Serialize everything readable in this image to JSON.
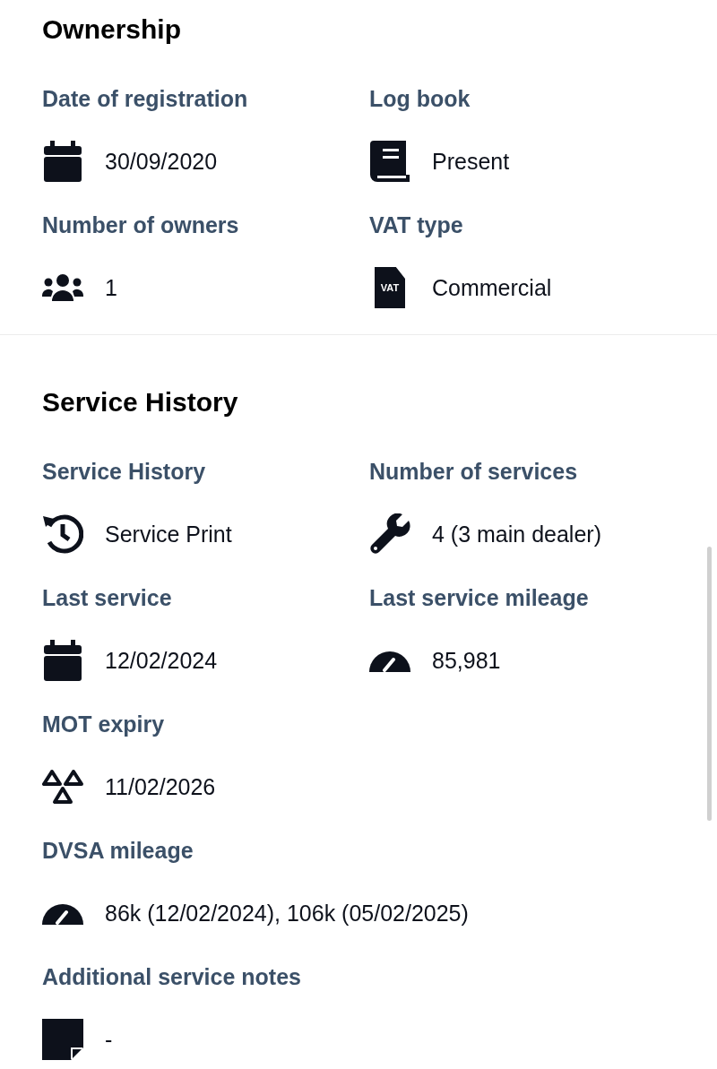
{
  "sections": [
    {
      "title": "Ownership",
      "fields": [
        {
          "label": "Date of registration",
          "kind": "calendar",
          "value": "30/09/2020"
        },
        {
          "label": "Log book",
          "kind": "book",
          "value": "Present"
        },
        {
          "label": "Number of owners",
          "kind": "people",
          "value": "1"
        },
        {
          "label": "VAT type",
          "kind": "document",
          "icon_text": "VAT",
          "value": "Commercial"
        }
      ]
    },
    {
      "title": "Service History",
      "fields": [
        {
          "label": "Service History",
          "kind": "history",
          "value": "Service Print"
        },
        {
          "label": "Number of services",
          "kind": "wrench",
          "value": "4 (3 main dealer)"
        },
        {
          "label": "Last service",
          "kind": "calendar",
          "value": "12/02/2024"
        },
        {
          "label": "Last service mileage",
          "kind": "gauge",
          "value": "85,981"
        },
        {
          "label": "MOT expiry",
          "kind": "triangles",
          "value": "11/02/2026"
        },
        {
          "label": "DVSA mileage",
          "kind": "gauge",
          "value": "86k (12/02/2024), 106k (05/02/2025)"
        },
        {
          "label": "Additional service notes",
          "kind": "note",
          "value": "-"
        }
      ]
    }
  ]
}
